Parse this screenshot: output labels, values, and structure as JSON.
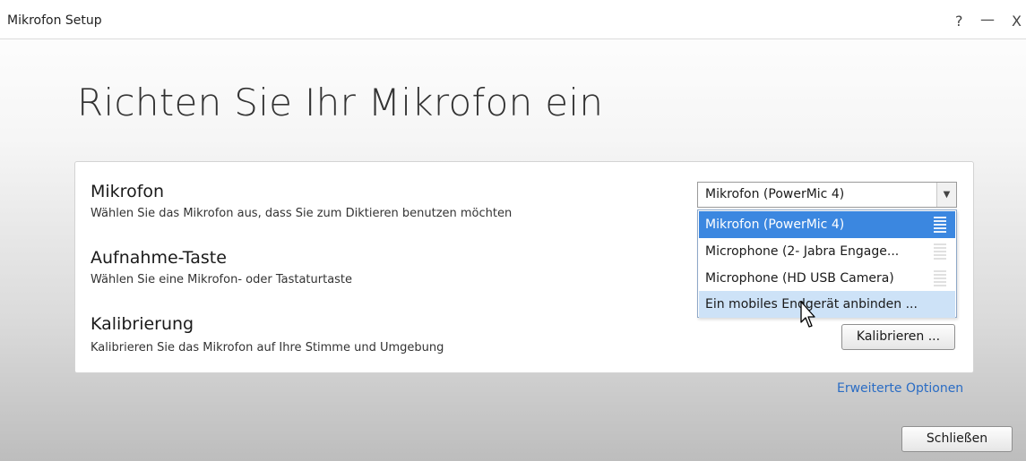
{
  "window": {
    "title": "Mikrofon Setup",
    "help_glyph": "?",
    "minimize_glyph": "—",
    "close_glyph": "X"
  },
  "headline": "Richten Sie Ihr Mikrofon ein",
  "sections": {
    "mikrofon": {
      "title": "Mikrofon",
      "description": "Wählen Sie das Mikrofon aus, dass Sie zum Diktieren benutzen möchten"
    },
    "aufnahme": {
      "title": "Aufnahme-Taste",
      "description": "Wählen Sie eine Mikrofon- oder Tastaturtaste"
    },
    "kalibrierung": {
      "title": "Kalibrierung",
      "description": "Kalibrieren Sie das Mikrofon auf Ihre Stimme und Umgebung",
      "button_label": "Kalibrieren ..."
    }
  },
  "microphone_select": {
    "selected_value": "Mikrofon (PowerMic 4)",
    "options": [
      "Mikrofon (PowerMic 4)",
      "Microphone (2- Jabra Engage...",
      "Microphone (HD USB Camera)",
      "Ein mobiles Endgerät anbinden ..."
    ],
    "highlighted_index": 0,
    "hovered_index": 3
  },
  "footer": {
    "advanced_link": "Erweiterte Optionen",
    "close_button": "Schließen"
  },
  "colors": {
    "selection_blue": "#3b87e0",
    "hover_blue": "#cde2f7",
    "link_blue": "#2a6cc4"
  }
}
